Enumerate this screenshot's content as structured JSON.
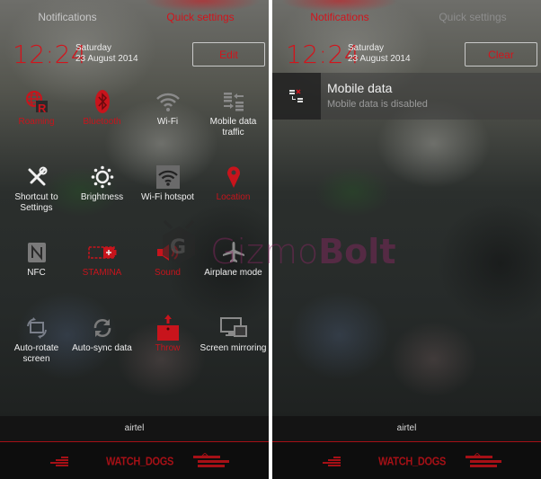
{
  "left_panel": {
    "tabs": [
      {
        "label": "Notifications",
        "active": false
      },
      {
        "label": "Quick settings",
        "active": true
      }
    ],
    "clock": {
      "time": "12:24",
      "day": "Saturday",
      "date": "23 August 2014"
    },
    "action_button": "Edit",
    "tiles": [
      {
        "label": "Roaming",
        "icon": "roaming-icon",
        "active": true
      },
      {
        "label": "Bluetooth",
        "icon": "bluetooth-icon",
        "active": true
      },
      {
        "label": "Wi-Fi",
        "icon": "wifi-icon",
        "active": false
      },
      {
        "label": "Mobile data traffic",
        "icon": "mobile-data-icon",
        "active": false
      },
      {
        "label": "Shortcut to Settings",
        "icon": "tools-icon",
        "active": false
      },
      {
        "label": "Brightness",
        "icon": "brightness-icon",
        "active": false
      },
      {
        "label": "Wi-Fi hotspot",
        "icon": "hotspot-icon",
        "active": false
      },
      {
        "label": "Location",
        "icon": "location-pin-icon",
        "active": true
      },
      {
        "label": "NFC",
        "icon": "nfc-icon",
        "active": false
      },
      {
        "label": "STAMINA",
        "icon": "battery-stamina-icon",
        "active": true
      },
      {
        "label": "Sound",
        "icon": "speaker-icon",
        "active": true
      },
      {
        "label": "Airplane mode",
        "icon": "airplane-icon",
        "active": false
      },
      {
        "label": "Auto-rotate screen",
        "icon": "rotate-icon",
        "active": false
      },
      {
        "label": "Auto-sync data",
        "icon": "sync-icon",
        "active": false
      },
      {
        "label": "Throw",
        "icon": "throw-icon",
        "active": true
      },
      {
        "label": "Screen mirroring",
        "icon": "screen-mirroring-icon",
        "active": false
      }
    ],
    "carrier": "airtel",
    "nav_brand": "WATCH_DOGS"
  },
  "right_panel": {
    "tabs": [
      {
        "label": "Notifications",
        "active": true
      },
      {
        "label": "Quick settings",
        "active": false
      }
    ],
    "clock": {
      "time": "12:24",
      "day": "Saturday",
      "date": "23 August 2014"
    },
    "action_button": "Clear",
    "notification": {
      "title": "Mobile data",
      "subtitle": "Mobile data is disabled",
      "icon": "mobile-data-disabled-icon"
    },
    "carrier": "airtel",
    "nav_brand": "WATCH_DOGS"
  },
  "watermark": {
    "part1": "Gizmo",
    "part2": "Bolt"
  },
  "colors": {
    "accent": "#d2141c",
    "inactive_icon": "#8a8a8a",
    "text": "#f0f0f0"
  }
}
